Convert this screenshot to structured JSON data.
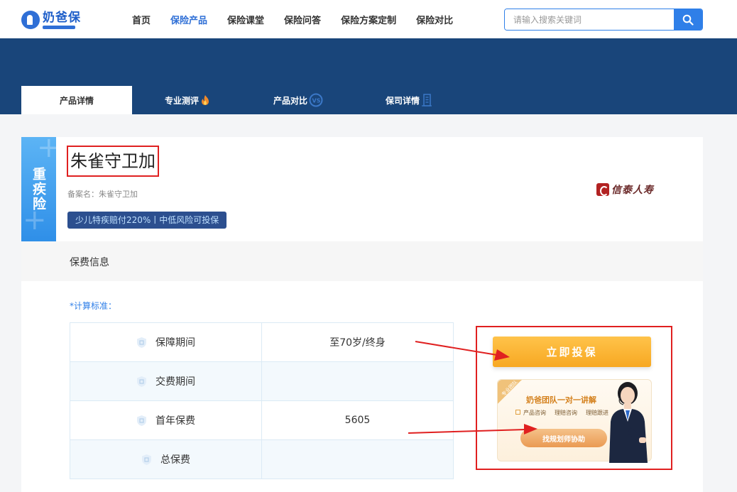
{
  "header": {
    "logo_text": "奶爸保",
    "nav": [
      "首页",
      "保险产品",
      "保险课堂",
      "保险问答",
      "保险方案定制",
      "保险对比"
    ],
    "active_nav": "保险产品",
    "search_placeholder": "请输入搜索关键词"
  },
  "tabs": [
    "产品详情",
    "专业测评",
    "产品对比",
    "保司详情"
  ],
  "product": {
    "type_label": "重疾险",
    "title": "朱雀守卫加",
    "record_name": "备案名：朱雀守卫加",
    "tagline": "少儿特疾赔付220%丨中低风险可投保",
    "company_logo_text": "信泰人寿"
  },
  "premium": {
    "section_title": "保费信息",
    "calc_label": "*计算标准：",
    "rows": [
      {
        "label": "保障期间",
        "value": "至70岁/终身"
      },
      {
        "label": "交费期间",
        "value": ""
      },
      {
        "label": "首年保费",
        "value": "5605"
      },
      {
        "label": "总保费",
        "value": ""
      }
    ]
  },
  "promo": {
    "buy_button": "立即投保",
    "ribbon": "专业团队",
    "consult_title": "奶爸团队一对一讲解",
    "consult_items": [
      "产品咨询",
      "理赔咨询",
      "理赔跟进"
    ],
    "consult_button": "找规划师协助"
  },
  "colors": {
    "brand": "#2f7fe8",
    "banner": "#19457a",
    "highlight_border": "#e02020",
    "buy_button": "#f7a822"
  }
}
